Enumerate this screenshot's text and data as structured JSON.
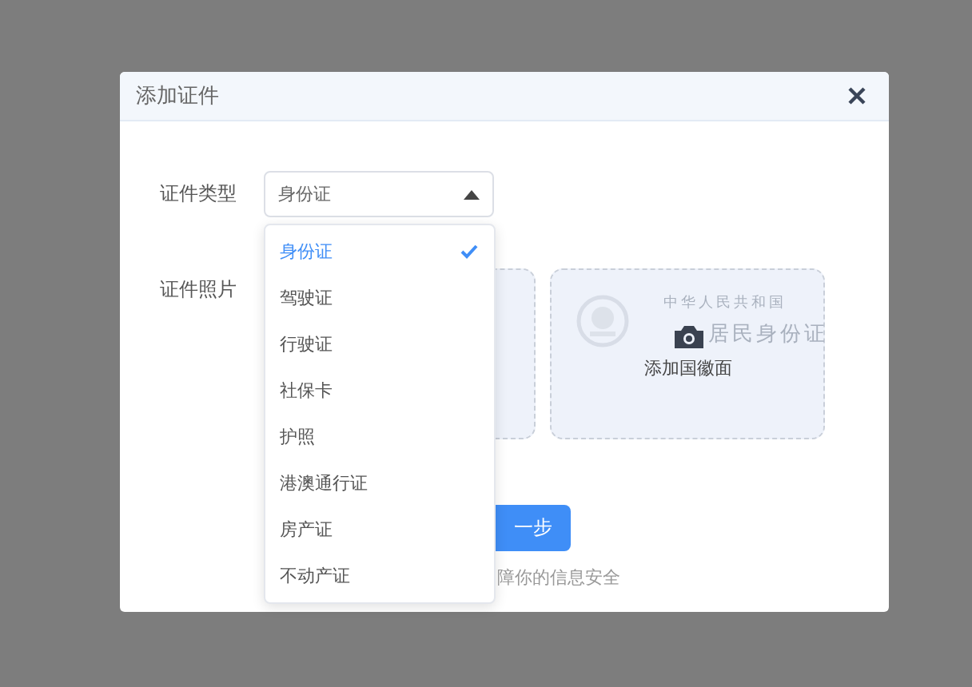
{
  "dialog": {
    "title": "添加证件"
  },
  "type_field": {
    "label": "证件类型",
    "value": "身份证",
    "expanded": true
  },
  "photo_field": {
    "label": "证件照片",
    "cards": [
      {
        "kind": "front"
      },
      {
        "kind": "back",
        "emblem_title": "中华人民共和国",
        "card_name": "居民身份证",
        "caption": "添加国徽面"
      }
    ]
  },
  "next_button": {
    "label": "一步"
  },
  "security_note": "障你的信息安全",
  "dropdown": {
    "options": [
      {
        "label": "身份证",
        "selected": true
      },
      {
        "label": "驾驶证",
        "selected": false
      },
      {
        "label": "行驶证",
        "selected": false
      },
      {
        "label": "社保卡",
        "selected": false
      },
      {
        "label": "护照",
        "selected": false
      },
      {
        "label": "港澳通行证",
        "selected": false
      },
      {
        "label": "房产证",
        "selected": false
      },
      {
        "label": "不动产证",
        "selected": false
      }
    ]
  }
}
